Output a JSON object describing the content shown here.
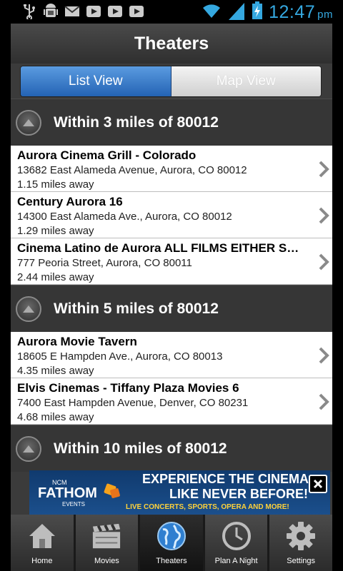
{
  "status_bar": {
    "icons": [
      "usb-icon",
      "android-debug-icon",
      "gmail-icon",
      "youtube-icon",
      "youtube-icon",
      "youtube-icon"
    ],
    "time": "12:47",
    "ampm": "pm",
    "accent": "#35a8e0"
  },
  "header": {
    "title": "Theaters"
  },
  "view_toggle": {
    "list_label": "List View",
    "map_label": "Map View",
    "selected": "List View"
  },
  "sections": [
    {
      "heading": "Within 3 miles of 80012",
      "theaters": [
        {
          "name": "Aurora Cinema Grill - Colorado",
          "address": "13682 East Alameda Avenue, Aurora, CO 80012",
          "distance": "1.15 miles away"
        },
        {
          "name": "Century Aurora 16",
          "address": "14300 East Alameda Ave., Aurora, CO 80012",
          "distance": "1.29 miles away"
        },
        {
          "name": "Cinema Latino de Aurora   ALL FILMS EITHER SUBTITLED OR DUBBED IN SPANISH",
          "address": "777 Peoria Street, Aurora, CO 80011",
          "distance": "2.44 miles away"
        }
      ]
    },
    {
      "heading": "Within 5 miles of 80012",
      "theaters": [
        {
          "name": "Aurora Movie Tavern",
          "address": "18605 E Hampden Ave., Aurora, CO 80013",
          "distance": "4.35 miles away"
        },
        {
          "name": "Elvis Cinemas - Tiffany Plaza Movies 6",
          "address": "7400 East Hampden Avenue, Denver, CO 80231",
          "distance": "4.68 miles away"
        }
      ]
    },
    {
      "heading": "Within 10 miles of 80012",
      "theaters": []
    }
  ],
  "ad": {
    "brand_top": "NCM",
    "brand": "FATHOM",
    "brand_sub": "EVENTS",
    "headline_1": "EXPERIENCE THE CINEMA",
    "headline_2": "LIKE NEVER BEFORE!",
    "subline": "LIVE CONCERTS, SPORTS, OPERA AND MORE!"
  },
  "tabs": [
    {
      "label": "Home",
      "icon": "home-icon"
    },
    {
      "label": "Movies",
      "icon": "clapperboard-icon"
    },
    {
      "label": "Theaters",
      "icon": "globe-icon"
    },
    {
      "label": "Plan A Night",
      "icon": "clock-icon"
    },
    {
      "label": "Settings",
      "icon": "gear-icon"
    }
  ],
  "selected_tab": "Theaters"
}
